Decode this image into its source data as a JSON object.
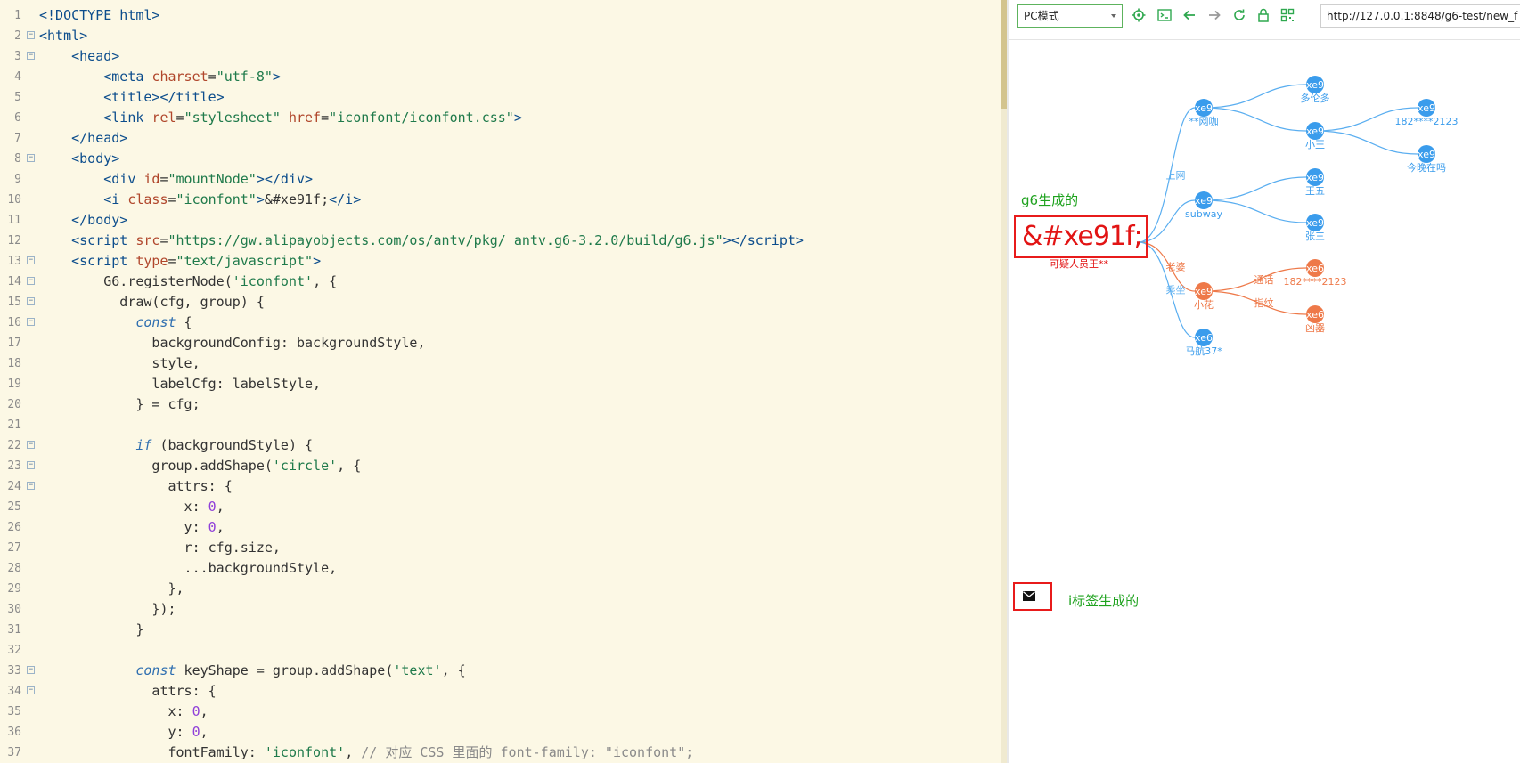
{
  "editor": {
    "lines": [
      {
        "n": "1",
        "fold": "",
        "html": "<span class=\"tok-tag\">&lt;!DOCTYPE html&gt;</span>"
      },
      {
        "n": "2",
        "fold": "⊟",
        "html": "<span class=\"tok-tag\">&lt;html&gt;</span>"
      },
      {
        "n": "3",
        "fold": "⊟",
        "html": "    <span class=\"tok-tag\">&lt;head&gt;</span>"
      },
      {
        "n": "4",
        "fold": "",
        "html": "        <span class=\"tok-tag\">&lt;meta</span> <span class=\"tok-attr\">charset</span>=<span class=\"tok-str\">\"utf-8\"</span><span class=\"tok-tag\">&gt;</span>"
      },
      {
        "n": "5",
        "fold": "",
        "html": "        <span class=\"tok-tag\">&lt;title&gt;&lt;/title&gt;</span>"
      },
      {
        "n": "6",
        "fold": "",
        "html": "        <span class=\"tok-tag\">&lt;link</span> <span class=\"tok-attr\">rel</span>=<span class=\"tok-str\">\"stylesheet\"</span> <span class=\"tok-attr\">href</span>=<span class=\"tok-str\">\"iconfont/iconfont.css\"</span><span class=\"tok-tag\">&gt;</span>"
      },
      {
        "n": "7",
        "fold": "",
        "html": "    <span class=\"tok-tag\">&lt;/head&gt;</span>"
      },
      {
        "n": "8",
        "fold": "⊟",
        "html": "    <span class=\"tok-tag\">&lt;body&gt;</span>"
      },
      {
        "n": "9",
        "fold": "",
        "html": "        <span class=\"tok-tag\">&lt;div</span> <span class=\"tok-attr\">id</span>=<span class=\"tok-str\">\"mountNode\"</span><span class=\"tok-tag\">&gt;&lt;/div&gt;</span>"
      },
      {
        "n": "10",
        "fold": "",
        "html": "        <span class=\"tok-tag\">&lt;i</span> <span class=\"tok-attr\">class</span>=<span class=\"tok-str\">\"iconfont\"</span><span class=\"tok-tag\">&gt;</span>&amp;#xe91f;<span class=\"tok-tag\">&lt;/i&gt;</span>"
      },
      {
        "n": "11",
        "fold": "",
        "html": "    <span class=\"tok-tag\">&lt;/body&gt;</span>"
      },
      {
        "n": "12",
        "fold": "",
        "html": "    <span class=\"tok-tag\">&lt;script</span> <span class=\"tok-attr\">src</span>=<span class=\"tok-str\">\"https://gw.alipayobjects.com/os/antv/pkg/_antv.g6-3.2.0/build/g6.js\"</span><span class=\"tok-tag\">&gt;&lt;/script&gt;</span>"
      },
      {
        "n": "13",
        "fold": "⊟",
        "html": "    <span class=\"tok-tag\">&lt;script</span> <span class=\"tok-attr\">type</span>=<span class=\"tok-str\">\"text/javascript\"</span><span class=\"tok-tag\">&gt;</span>"
      },
      {
        "n": "14",
        "fold": "⊟",
        "html": "        G6.registerNode(<span class=\"tok-str\">'iconfont'</span>, {"
      },
      {
        "n": "15",
        "fold": "⊟",
        "html": "          draw(cfg, group) {"
      },
      {
        "n": "16",
        "fold": "⊟",
        "html": "            <span class=\"tok-kw\">const</span> {"
      },
      {
        "n": "17",
        "fold": "",
        "html": "              backgroundConfig: backgroundStyle,"
      },
      {
        "n": "18",
        "fold": "",
        "html": "              style,"
      },
      {
        "n": "19",
        "fold": "",
        "html": "              labelCfg: labelStyle,"
      },
      {
        "n": "20",
        "fold": "",
        "html": "            } = cfg;"
      },
      {
        "n": "21",
        "fold": "",
        "html": ""
      },
      {
        "n": "22",
        "fold": "⊟",
        "html": "            <span class=\"tok-kw\">if</span> (backgroundStyle) {"
      },
      {
        "n": "23",
        "fold": "⊟",
        "html": "              group.addShape(<span class=\"tok-str\">'circle'</span>, {"
      },
      {
        "n": "24",
        "fold": "⊟",
        "html": "                attrs: {"
      },
      {
        "n": "25",
        "fold": "",
        "html": "                  x: <span class=\"tok-num\">0</span>,"
      },
      {
        "n": "26",
        "fold": "",
        "html": "                  y: <span class=\"tok-num\">0</span>,"
      },
      {
        "n": "27",
        "fold": "",
        "html": "                  r: cfg.size,"
      },
      {
        "n": "28",
        "fold": "",
        "html": "                  ...backgroundStyle,"
      },
      {
        "n": "29",
        "fold": "",
        "html": "                },"
      },
      {
        "n": "30",
        "fold": "",
        "html": "              });"
      },
      {
        "n": "31",
        "fold": "",
        "html": "            }"
      },
      {
        "n": "32",
        "fold": "",
        "html": ""
      },
      {
        "n": "33",
        "fold": "⊟",
        "html": "            <span class=\"tok-kw\">const</span> keyShape = group.addShape(<span class=\"tok-str\">'text'</span>, {"
      },
      {
        "n": "34",
        "fold": "⊟",
        "html": "              attrs: {"
      },
      {
        "n": "35",
        "fold": "",
        "html": "                x: <span class=\"tok-num\">0</span>,"
      },
      {
        "n": "36",
        "fold": "",
        "html": "                y: <span class=\"tok-num\">0</span>,"
      },
      {
        "n": "37",
        "fold": "",
        "html": "                fontFamily: <span class=\"tok-str\">'iconfont'</span>, <span class=\"tok-com\">// 对应 CSS 里面的 font-family: \"iconfont\";</span>"
      }
    ]
  },
  "browser": {
    "mode_select": "PC模式",
    "url": "http://127.0.0.1:8848/g6-test/new_f",
    "toolbar_icons": [
      "settings-icon",
      "console-icon",
      "back-arrow-icon",
      "forward-arrow-icon",
      "refresh-icon",
      "lock-icon",
      "qr-code-icon"
    ]
  },
  "preview": {
    "label_g6": "g6生成的",
    "big_icon_text": "&#xe91f;",
    "label_i_tag": "i标签生成的",
    "mail_icon": "mail-icon",
    "graph": {
      "root_label": "可疑人员王**",
      "nodes": [
        {
          "id": "wangka",
          "icon": "xe9",
          "label": "**网咖",
          "color": "#3a9cec"
        },
        {
          "id": "subway",
          "icon": "xe9",
          "label": "subway",
          "color": "#3a9cec"
        },
        {
          "id": "xiaohua",
          "icon": "xe9",
          "label": "小花",
          "color": "#ee7949"
        },
        {
          "id": "mahang",
          "icon": "xe6",
          "label": "马航37*",
          "color": "#3a9cec"
        },
        {
          "id": "duoluoduo",
          "icon": "xe9",
          "label": "多伦多",
          "color": "#3a9cec"
        },
        {
          "id": "xiaowang",
          "icon": "xe9",
          "label": "小王",
          "color": "#3a9cec"
        },
        {
          "id": "wangwu",
          "icon": "xe9",
          "label": "王五",
          "color": "#3a9cec"
        },
        {
          "id": "zhangsan",
          "icon": "xe9",
          "label": "张三",
          "color": "#3a9cec"
        },
        {
          "id": "phone1",
          "icon": "xe6",
          "label": "182****2123",
          "color": "#ee7949"
        },
        {
          "id": "xiongqi",
          "icon": "xe6",
          "label": "凶器",
          "color": "#ee7949"
        },
        {
          "id": "phone2",
          "icon": "xe9",
          "label": "182****2123",
          "color": "#3a9cec"
        },
        {
          "id": "jinwan",
          "icon": "xe9",
          "label": "今晚在吗",
          "color": "#3a9cec"
        }
      ],
      "edges": [
        {
          "from": "root",
          "to": "wangka",
          "label": "上网",
          "color": "#5aaef0"
        },
        {
          "from": "root",
          "to": "subway",
          "label": "",
          "color": "#5aaef0"
        },
        {
          "from": "root",
          "to": "xiaohua",
          "label": "老婆",
          "color": "#ee7949"
        },
        {
          "from": "root",
          "to": "mahang",
          "label": "乘坐",
          "color": "#5aaef0"
        },
        {
          "from": "wangka",
          "to": "duoluoduo",
          "label": "",
          "color": "#5aaef0"
        },
        {
          "from": "wangka",
          "to": "xiaowang",
          "label": "",
          "color": "#5aaef0"
        },
        {
          "from": "subway",
          "to": "wangwu",
          "label": "",
          "color": "#5aaef0"
        },
        {
          "from": "subway",
          "to": "zhangsan",
          "label": "",
          "color": "#5aaef0"
        },
        {
          "from": "xiaohua",
          "to": "phone1",
          "label": "通话",
          "color": "#ee7949"
        },
        {
          "from": "xiaohua",
          "to": "xiongqi",
          "label": "指纹",
          "color": "#ee7949"
        },
        {
          "from": "xiaowang",
          "to": "phone2",
          "label": "",
          "color": "#5aaef0"
        },
        {
          "from": "xiaowang",
          "to": "jinwan",
          "label": "",
          "color": "#5aaef0"
        }
      ]
    }
  }
}
